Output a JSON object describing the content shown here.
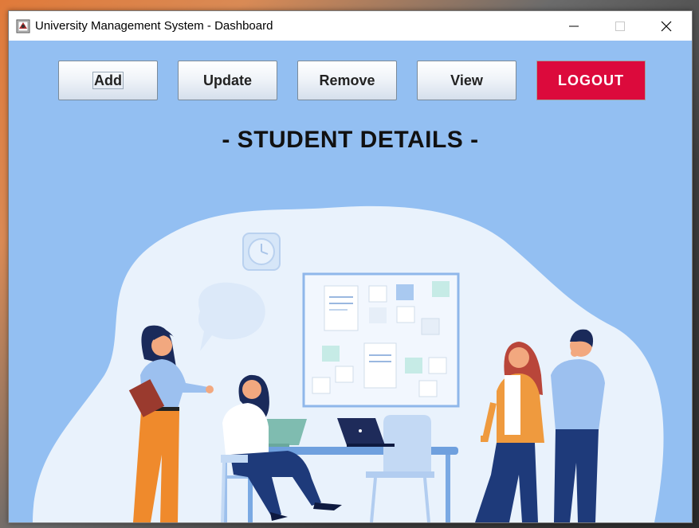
{
  "window": {
    "title": "University Management System - Dashboard"
  },
  "toolbar": {
    "add_label": "Add",
    "update_label": "Update",
    "remove_label": "Remove",
    "view_label": "View",
    "logout_label": "LOGOUT"
  },
  "page": {
    "heading": "- STUDENT DETAILS -"
  },
  "colors": {
    "background": "#93bff2",
    "logout": "#dc0a3c",
    "blob": "#e9f2fc"
  },
  "icons": {
    "app": "app-icon",
    "minimize": "minimize-icon",
    "maximize": "maximize-icon",
    "close": "close-icon",
    "illustration": "students-meeting-illustration"
  }
}
